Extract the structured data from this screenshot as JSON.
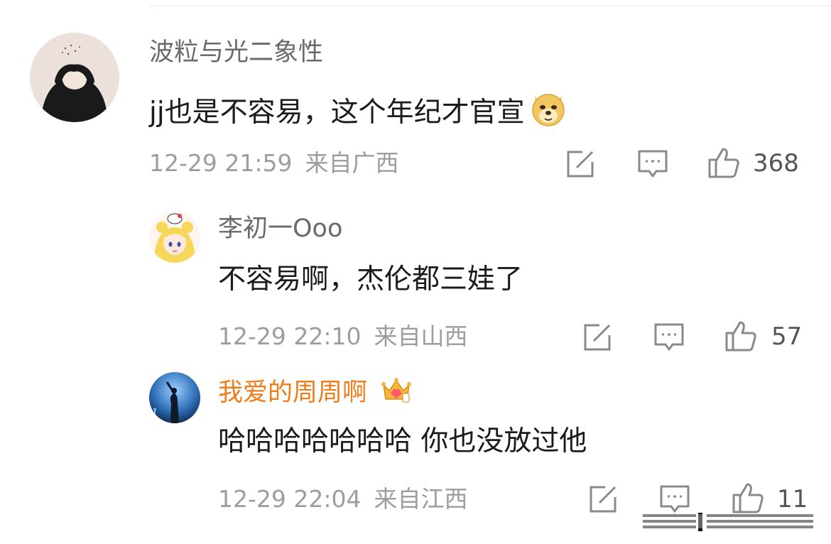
{
  "comments": [
    {
      "username": "波粒与光二象性",
      "text": "jj也是不容易，这个年纪才官宣",
      "date": "12-29 21:59",
      "location": "来自广西",
      "likes": "368",
      "emoji": "doge-emoji"
    },
    {
      "username": "李初一Ooo",
      "text": "不容易啊，杰伦都三娃了",
      "date": "12-29 22:10",
      "location": "来自山西",
      "likes": "57"
    },
    {
      "username": "我爱的周周啊",
      "text": "哈哈哈哈哈哈哈 你也没放过他",
      "date": "12-29 22:04",
      "location": "来自江西",
      "likes": "11",
      "badge": "crown-badge-icon",
      "username_color": "#f07d1b"
    }
  ]
}
